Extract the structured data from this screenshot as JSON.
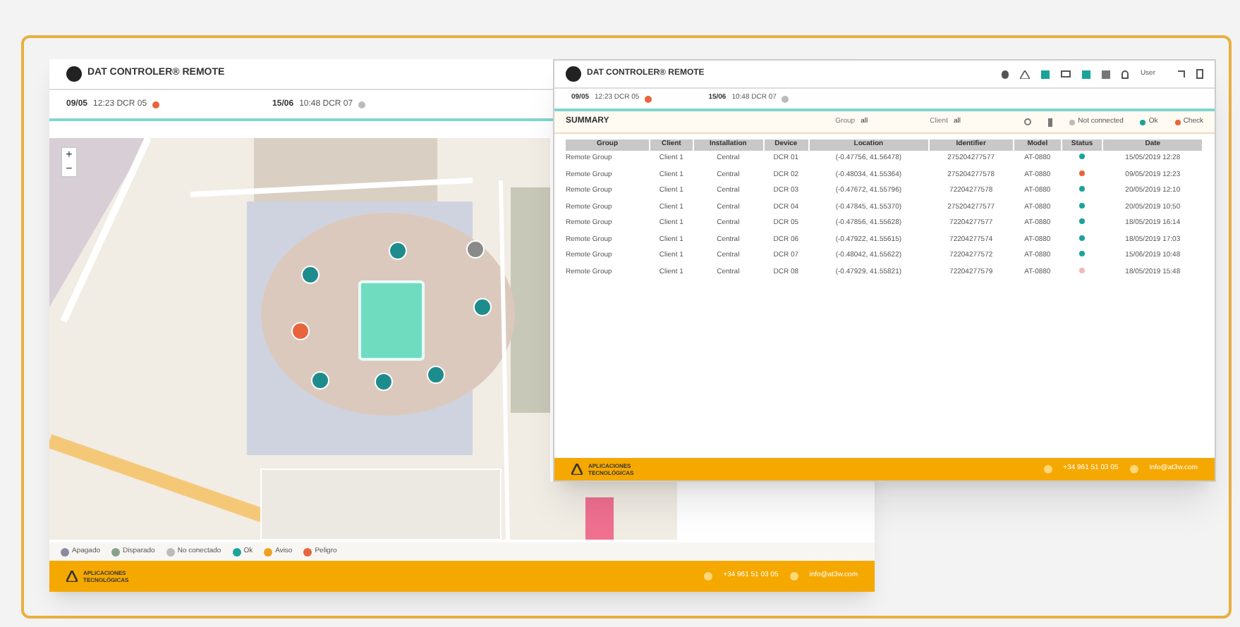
{
  "map_window": {
    "title": "DAT CONTROLER® REMOTE",
    "info": [
      {
        "date": "09/05",
        "text": "12:23 DCR 05",
        "color": "#e8643c"
      },
      {
        "date": "15/06",
        "text": "10:48 DCR 07",
        "color": "#bbbbbb"
      }
    ],
    "zoom_controls": [
      "+",
      "−"
    ],
    "markers": [
      {
        "color": "#1e8c8c"
      },
      {
        "color": "#1e8c8c"
      },
      {
        "color": "#8a8a8a"
      },
      {
        "color": "#1e8c8c"
      },
      {
        "color": "#e8643c"
      },
      {
        "color": "#1e8c8c"
      },
      {
        "color": "#1e8c8c"
      },
      {
        "color": "#1e8c8c"
      }
    ],
    "legend": [
      {
        "label": "Apagado",
        "color": "#8a8aa0"
      },
      {
        "label": "Disparado",
        "color": "#8aa08a"
      },
      {
        "label": "No conectado",
        "color": "#bbbbbb"
      },
      {
        "label": "Ok",
        "color": "#1aa39a"
      },
      {
        "label": "Aviso",
        "color": "#f0a020"
      },
      {
        "label": "Peligro",
        "color": "#e8643c"
      }
    ],
    "footer": {
      "brand": "APLICACIONES TECNOLÓGICAS",
      "phone": "+34 961 51 03 05",
      "email": "info@at3w.com"
    }
  },
  "summary_window": {
    "title": "DAT CONTROLER® REMOTE",
    "user": "User",
    "info": [
      {
        "date": "09/05",
        "text": "12:23 DCR 05",
        "color": "#e8643c"
      },
      {
        "date": "15/06",
        "text": "10:48 DCR 07",
        "color": "#bbbbbb"
      }
    ],
    "heading": "SUMMARY",
    "filters": [
      {
        "label": "Group",
        "value": "all"
      },
      {
        "label": "Client",
        "value": "all"
      }
    ],
    "status_legend": [
      {
        "label": "Not connected",
        "color": "#bbbbbb"
      },
      {
        "label": "Ok",
        "color": "#1aa39a"
      },
      {
        "label": "Check",
        "color": "#e8643c"
      }
    ],
    "table": {
      "columns": [
        "Group",
        "Client",
        "Installation",
        "Device",
        "Location",
        "Identifier",
        "Model",
        "Status",
        "Date"
      ],
      "rows": [
        {
          "cells": [
            "Remote Group",
            "Client 1",
            "Central",
            "DCR 01",
            "(-0.47756, 41.56478)",
            "275204277577",
            "AT-0880",
            "15/05/2019 12:28"
          ],
          "color": "#1aa39a"
        },
        {
          "cells": [
            "Remote Group",
            "Client 1",
            "Central",
            "DCR 02",
            "(-0.48034, 41.55364)",
            "275204277578",
            "AT-0880",
            "09/05/2019 12:23"
          ],
          "color": "#e8643c"
        },
        {
          "cells": [
            "Remote Group",
            "Client 1",
            "Central",
            "DCR 03",
            "(-0.47672, 41.55796)",
            "72204277578",
            "AT-0880",
            "20/05/2019 12:10"
          ],
          "color": "#1aa39a"
        },
        {
          "cells": [
            "Remote Group",
            "Client 1",
            "Central",
            "DCR 04",
            "(-0.47845, 41.55370)",
            "275204277577",
            "AT-0880",
            "20/05/2019 10:50"
          ],
          "color": "#1aa39a"
        },
        {
          "cells": [
            "Remote Group",
            "Client 1",
            "Central",
            "DCR 05",
            "(-0.47856, 41.55628)",
            "72204277577",
            "AT-0880",
            "18/05/2019 16:14"
          ],
          "color": "#1aa39a"
        },
        {
          "cells": [
            "Remote Group",
            "Client 1",
            "Central",
            "DCR 06",
            "(-0.47922, 41.55615)",
            "72204277574",
            "AT-0880",
            "18/05/2019 17:03"
          ],
          "color": "#1aa39a"
        },
        {
          "cells": [
            "Remote Group",
            "Client 1",
            "Central",
            "DCR 07",
            "(-0.48042, 41.55622)",
            "72204277572",
            "AT-0880",
            "15/06/2019 10:48"
          ],
          "color": "#1aa39a"
        },
        {
          "cells": [
            "Remote Group",
            "Client 1",
            "Central",
            "DCR 08",
            "(-0.47929, 41.55821)",
            "72204277579",
            "AT-0880",
            "18/05/2019 15:48"
          ],
          "color": "#f0b8b8"
        }
      ]
    },
    "footer": {
      "brand": "APLICACIONES TECNOLÓGICAS",
      "phone": "+34 961 51 03 05",
      "email": "info@at3w.com"
    }
  }
}
